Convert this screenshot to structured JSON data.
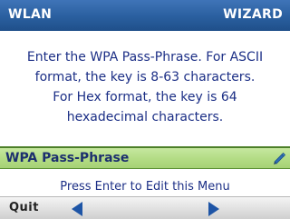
{
  "header": {
    "left_title": "WLAN",
    "right_title": "WIZARD"
  },
  "instructions": {
    "lines": [
      "Enter the WPA Pass-Phrase. For ASCII",
      "format, the key is 8-63 characters.",
      "For Hex format, the key is 64",
      "hexadecimal characters."
    ]
  },
  "menu": {
    "selected_item": "WPA Pass-Phrase",
    "icon": "pencil-edit-icon"
  },
  "hint": "Press Enter to Edit this Menu",
  "softkeys": {
    "left_label": "Quit",
    "prev_icon": "arrow-left-icon",
    "next_icon": "arrow-right-icon"
  },
  "colors": {
    "header_bg": "#2a5f9f",
    "text_blue": "#1c2f86",
    "selected_bg": "#b4dd86",
    "arrow_blue": "#1e55a6"
  }
}
